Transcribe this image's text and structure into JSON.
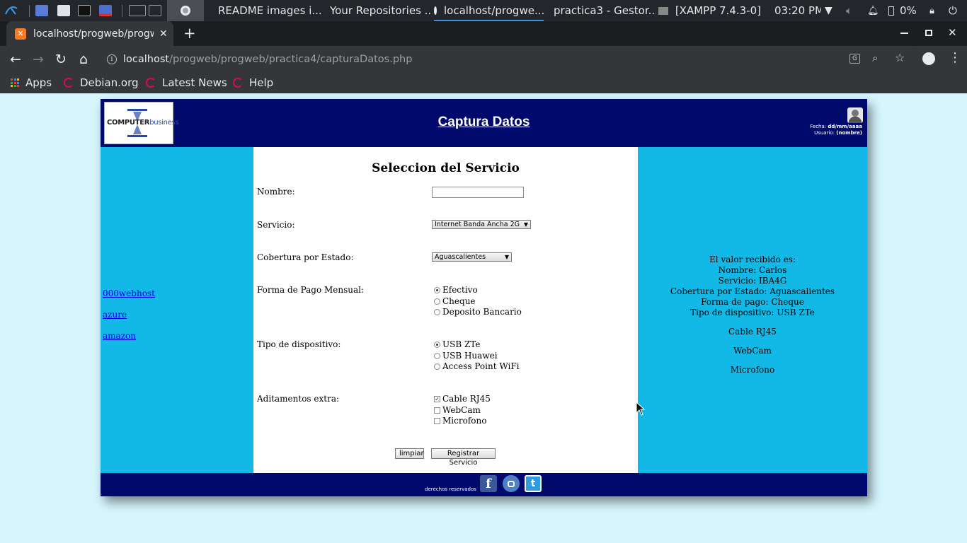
{
  "taskbar": {
    "windows": [
      {
        "label": "README images i..."
      },
      {
        "label": "Your Repositories ..."
      },
      {
        "label": "localhost/progwe..."
      },
      {
        "label": "practica3 - Gestor..."
      },
      {
        "label": "[XAMPP 7.4.3-0]"
      }
    ],
    "clock": "03:20 PM",
    "battery": "0%"
  },
  "browser": {
    "tab_title": "localhost/progweb/progw",
    "url_host": "localhost",
    "url_path": "/progweb/progweb/practica4/capturaDatos.php",
    "bookmarks": [
      "Apps",
      "Debian.org",
      "Latest News",
      "Help"
    ]
  },
  "page": {
    "logo": {
      "word1": "COMPUTER",
      "word2": "business"
    },
    "title": "Captura Datos",
    "user": {
      "fecha_label": "Fecha:",
      "fecha_value": "dd/mm/aaaa",
      "usuario_label": "Usuario:",
      "usuario_value": "(nombre)"
    },
    "left_links": [
      "000webhost",
      "azure",
      "amazon"
    ],
    "form": {
      "heading": "Seleccion del Servicio",
      "nombre_label": "Nombre:",
      "nombre_value": "",
      "servicio_label": "Servicio:",
      "servicio_selected": "Internet Banda Ancha 2G",
      "cobertura_label": "Cobertura por Estado:",
      "cobertura_selected": "Aguascalientes",
      "pago_label": "Forma de Pago Mensual:",
      "pago_options": [
        "Efectivo",
        "Cheque",
        "Deposito Bancario"
      ],
      "dispositivo_label": "Tipo de dispositivo:",
      "dispositivo_options": [
        "USB ZTe",
        "USB Huawei",
        "Access Point WiFi"
      ],
      "extras_label": "Aditamentos extra:",
      "extras_options": [
        "Cable RJ45",
        "WebCam",
        "Microfono"
      ],
      "reset_label": "limpiar",
      "submit_label": "Registrar Servicio"
    },
    "result": {
      "heading": "El valor recibido es:",
      "nombre": "Nombre: Carlos",
      "servicio": "Servicio: IBA4G",
      "cobertura": "Cobertura por Estado: Aguascalientes",
      "pago": "Forma de pago: Cheque",
      "dispositivo": "Tipo de dispositivo: USB ZTe",
      "extras": [
        "Cable RJ45",
        "WebCam",
        "Microfono"
      ]
    },
    "footer_text": "derechos reservados"
  },
  "colors": {
    "header_bg": "#000a6c",
    "side_bg": "#12b9e6",
    "page_bg": "#d6f5fd"
  },
  "icons": [
    "kali-menu-icon",
    "facebook-icon",
    "instagram-icon",
    "twitter-icon",
    "user-avatar-icon"
  ]
}
